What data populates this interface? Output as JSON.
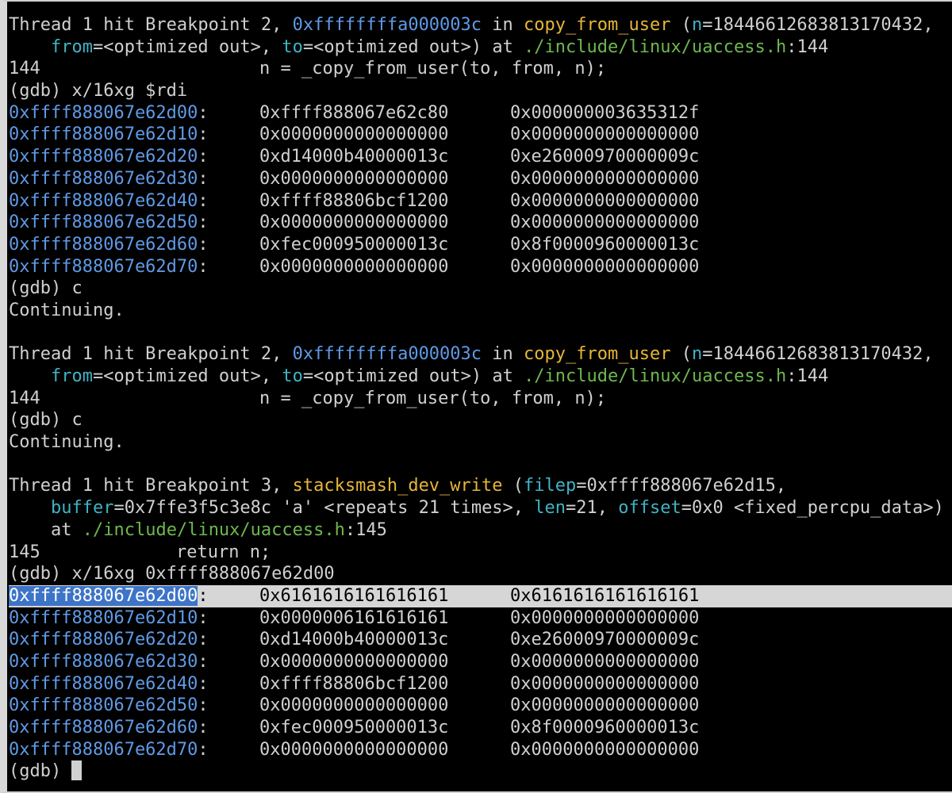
{
  "bp1": {
    "head": "Thread 1 hit Breakpoint 2, ",
    "pc": "0xffffffffa000003c",
    "in": " in ",
    "func": "copy_from_user",
    "open": " (",
    "n_name": "n",
    "n_val": "=18446612683813170432,",
    "from_name": "from",
    "from_val": "=<optimized out>, ",
    "to_name": "to",
    "to_val": "=<optimized out>) at ",
    "file": "./include/linux/uaccess.h",
    "line": ":144",
    "src_num": "144",
    "src_code": "n = _copy_from_user(to, from, n);"
  },
  "cmd1": "(gdb) x/16xg $rdi",
  "dump1": [
    {
      "addr": "0xffff888067e62d00",
      "v1": "0xffff888067e62c80",
      "v2": "0x000000003635312f"
    },
    {
      "addr": "0xffff888067e62d10",
      "v1": "0x0000000000000000",
      "v2": "0x0000000000000000"
    },
    {
      "addr": "0xffff888067e62d20",
      "v1": "0xd14000b40000013c",
      "v2": "0xe26000970000009c"
    },
    {
      "addr": "0xffff888067e62d30",
      "v1": "0x0000000000000000",
      "v2": "0x0000000000000000"
    },
    {
      "addr": "0xffff888067e62d40",
      "v1": "0xffff88806bcf1200",
      "v2": "0x0000000000000000"
    },
    {
      "addr": "0xffff888067e62d50",
      "v1": "0x0000000000000000",
      "v2": "0x0000000000000000"
    },
    {
      "addr": "0xffff888067e62d60",
      "v1": "0xfec000950000013c",
      "v2": "0x8f0000960000013c"
    },
    {
      "addr": "0xffff888067e62d70",
      "v1": "0x0000000000000000",
      "v2": "0x0000000000000000"
    }
  ],
  "cmd2": "(gdb) c",
  "cont": "Continuing.",
  "bp3": {
    "head": "Thread 1 hit Breakpoint 3, ",
    "func": "stacksmash_dev_write",
    "open": " (",
    "filep_name": "filep",
    "filep_val": "=0xffff888067e62d15,",
    "buffer_name": "buffer",
    "buffer_val": "=0x7ffe3f5c3e8c 'a' <repeats 21 times>, ",
    "len_name": "len",
    "len_val": "=21, ",
    "offset_name": "offset",
    "offset_val": "=0x0 <fixed_percpu_data>)",
    "at": "at ",
    "file": "./include/linux/uaccess.h",
    "line": ":145",
    "src_num": "145",
    "src_code": "return n;"
  },
  "cmd4": "(gdb) x/16xg 0xffff888067e62d00",
  "dump2": [
    {
      "addr": "0xffff888067e62d00",
      "v1": "0x6161616161616161",
      "v2": "0x6161616161616161"
    },
    {
      "addr": "0xffff888067e62d10",
      "v1": "0x0000006161616161",
      "v2": "0x0000000000000000"
    },
    {
      "addr": "0xffff888067e62d20",
      "v1": "0xd14000b40000013c",
      "v2": "0xe26000970000009c"
    },
    {
      "addr": "0xffff888067e62d30",
      "v1": "0x0000000000000000",
      "v2": "0x0000000000000000"
    },
    {
      "addr": "0xffff888067e62d40",
      "v1": "0xffff88806bcf1200",
      "v2": "0x0000000000000000"
    },
    {
      "addr": "0xffff888067e62d50",
      "v1": "0x0000000000000000",
      "v2": "0x0000000000000000"
    },
    {
      "addr": "0xffff888067e62d60",
      "v1": "0xfec000950000013c",
      "v2": "0x8f0000960000013c"
    },
    {
      "addr": "0xffff888067e62d70",
      "v1": "0x0000000000000000",
      "v2": "0x0000000000000000"
    }
  ],
  "prompt": "(gdb) ",
  "colon": ":",
  "colors": {
    "background": "#000000",
    "text": "#d0d0d0",
    "address": "#5f9ae6",
    "function": "#e6b637",
    "argument": "#3fb3c4",
    "path": "#6db84f",
    "selection": "#3d74c8",
    "highlight_row": "#d6d6d6"
  }
}
